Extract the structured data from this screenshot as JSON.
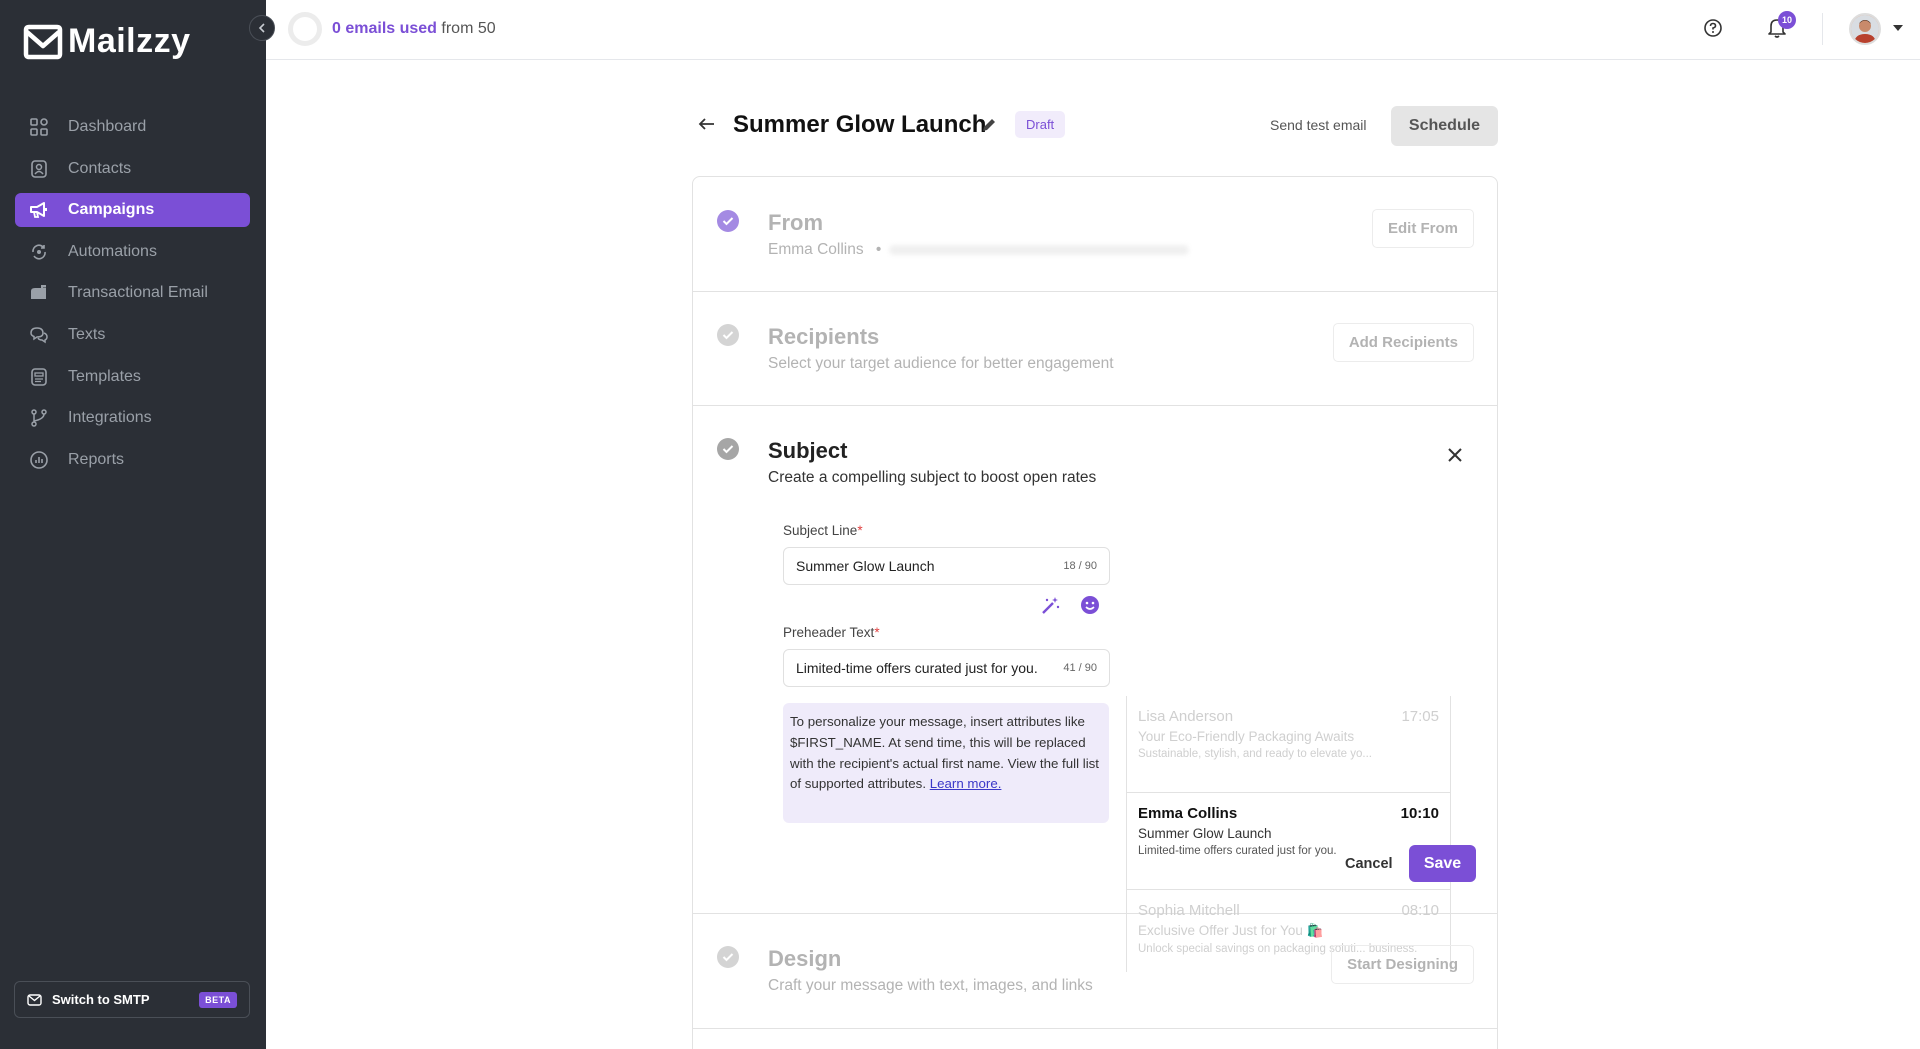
{
  "app": {
    "name": "Mailzzy"
  },
  "sidebar": {
    "items": [
      {
        "label": "Dashboard",
        "icon": "dashboard-icon"
      },
      {
        "label": "Contacts",
        "icon": "contacts-icon"
      },
      {
        "label": "Campaigns",
        "icon": "megaphone-icon",
        "active": true
      },
      {
        "label": "Automations",
        "icon": "automations-icon"
      },
      {
        "label": "Transactional Email",
        "icon": "mailbox-icon"
      },
      {
        "label": "Texts",
        "icon": "chat-icon"
      },
      {
        "label": "Templates",
        "icon": "templates-icon"
      },
      {
        "label": "Integrations",
        "icon": "branch-icon"
      },
      {
        "label": "Reports",
        "icon": "reports-icon"
      }
    ],
    "smtp": {
      "label": "Switch to SMTP",
      "badge": "BETA"
    }
  },
  "topbar": {
    "usage_used": "0 emails used",
    "usage_rest": "from 50",
    "notifications_count": "10"
  },
  "campaign": {
    "title": "Summer Glow Launch",
    "status": "Draft",
    "send_test": "Send test email",
    "schedule": "Schedule"
  },
  "sections": {
    "from": {
      "title": "From",
      "sender_name": "Emma Collins",
      "button": "Edit From"
    },
    "recipients": {
      "title": "Recipients",
      "subtitle": "Select your target audience for better engagement",
      "button": "Add Recipients"
    },
    "subject": {
      "title": "Subject",
      "subtitle": "Create a compelling subject to boost open rates",
      "subject_label": "Subject Line",
      "subject_value": "Summer Glow Launch",
      "subject_count": "18 / 90",
      "preheader_label": "Preheader Text",
      "preheader_value": "Limited-time offers curated just for you.",
      "preheader_count": "41 / 90",
      "info_text": "To personalize your message, insert attributes like $FIRST_NAME. At send time, this will be replaced with the recipient's actual first name. View the full list of supported attributes.",
      "info_link": "Learn more.",
      "cancel": "Cancel",
      "save": "Save"
    },
    "design": {
      "title": "Design",
      "subtitle": "Craft your message with text, images, and links",
      "button": "Start Designing"
    }
  },
  "inbox_preview": [
    {
      "name": "Lisa Anderson",
      "time": "17:05",
      "subject": "Your Eco-Friendly Packaging Awaits",
      "preview": "Sustainable, stylish, and ready to elevate yo..."
    },
    {
      "name": "Emma Collins",
      "time": "10:10",
      "subject": "Summer Glow Launch",
      "preview": "Limited-time offers curated just for you."
    },
    {
      "name": "Sophia Mitchell",
      "time": "08:10",
      "subject": "Exclusive Offer Just for You 🛍️",
      "preview": "Unlock special savings on packaging soluti... business."
    }
  ],
  "colors": {
    "accent": "#7b4fd6",
    "sidebar": "#2b2f36"
  }
}
